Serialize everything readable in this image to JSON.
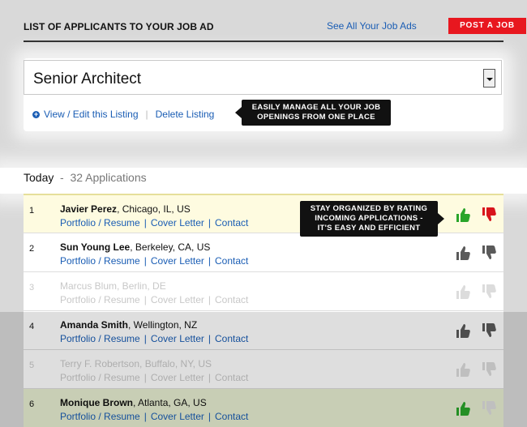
{
  "header": {
    "title": "LIST OF APPLICANTS TO YOUR JOB AD",
    "see_all": "See All Your Job Ads",
    "post_job": "POST A JOB"
  },
  "listing": {
    "selected_job": "Senior Architect",
    "view_edit": "View / Edit this Listing",
    "separator": "|",
    "delete": "Delete Listing"
  },
  "tooltips": {
    "manage_line1": "EASILY MANAGE ALL YOUR JOB",
    "manage_line2": "OPENINGS FROM ONE PLACE",
    "organize_line1": "STAY ORGANIZED BY RATING",
    "organize_line2": "INCOMING APPLICATIONS -",
    "organize_line3": "IT'S EASY AND EFFICIENT"
  },
  "applications": {
    "day": "Today",
    "dash": "-",
    "count_label": "32 Applications",
    "link_portfolio": "Portfolio / Resume",
    "link_cover": "Cover Letter",
    "link_contact": "Contact",
    "link_sep": "|",
    "rows": [
      {
        "num": "1",
        "name": "Javier Perez",
        "location": ", Chicago, IL, US",
        "up": "green",
        "down": "red"
      },
      {
        "num": "2",
        "name": "Sun Young Lee",
        "location": ", Berkeley, CA, US",
        "up": "gray",
        "down": "gray"
      },
      {
        "num": "3",
        "name": "Marcus Blum",
        "location": ", Berlin, DE",
        "up": "light",
        "down": "light"
      },
      {
        "num": "4",
        "name": "Amanda Smith",
        "location": ", Wellington, NZ",
        "up": "gray",
        "down": "gray"
      },
      {
        "num": "5",
        "name": "Terry F. Robertson",
        "location": ", Buffalo, NY, US",
        "up": "light",
        "down": "light"
      },
      {
        "num": "6",
        "name": "Monique Brown",
        "location": ", Atlanta, GA, US",
        "up": "green",
        "down": "light"
      }
    ]
  },
  "colors": {
    "accent_red": "#e8171f",
    "link_blue": "#1a5db4",
    "thumb_green": "#2aa52a",
    "thumb_red": "#d8141c",
    "thumb_gray": "#5a5a5a",
    "thumb_light": "#dcdcdc"
  }
}
